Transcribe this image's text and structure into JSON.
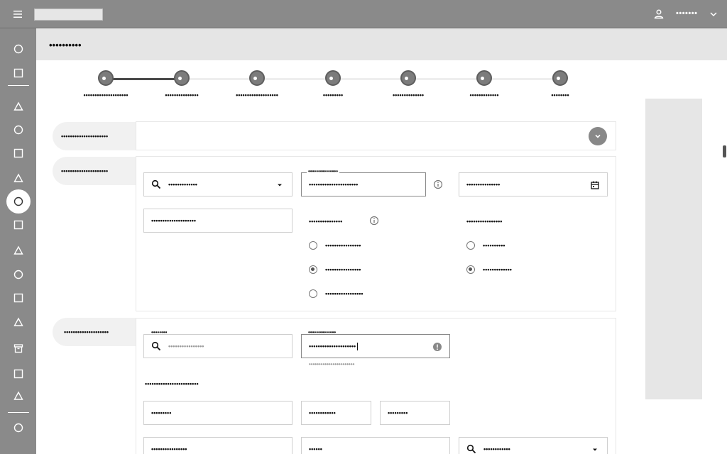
{
  "topbar": {
    "app_name": "",
    "user_name": "•••••••",
    "icons": {
      "menu": "hamburger-icon",
      "user": "person-icon",
      "dropdown": "chevron-down-icon"
    }
  },
  "sidebar": {
    "items": [
      {
        "icon": "circle-icon"
      },
      {
        "icon": "square-icon"
      },
      {
        "icon": "triangle-icon"
      },
      {
        "icon": "circle-icon"
      },
      {
        "icon": "square-icon"
      },
      {
        "icon": "triangle-icon"
      },
      {
        "icon": "circle-icon",
        "active": true
      },
      {
        "icon": "square-icon"
      },
      {
        "icon": "triangle-icon"
      },
      {
        "icon": "circle-icon"
      },
      {
        "icon": "square-icon"
      },
      {
        "icon": "triangle-icon"
      },
      {
        "icon": "archive-icon"
      },
      {
        "icon": "square-icon"
      },
      {
        "icon": "triangle-icon"
      },
      {
        "icon": "circle-icon"
      }
    ]
  },
  "page": {
    "title": "••••••••••"
  },
  "stepper": {
    "completed_through": 1,
    "steps": [
      {
        "label": "••••••••••••••••••••"
      },
      {
        "label": "•••••••••••••••"
      },
      {
        "label": "•••••••••••••••••••"
      },
      {
        "label": "•••••••••"
      },
      {
        "label": "••••••••••••••"
      },
      {
        "label": "•••••••••••••"
      },
      {
        "label": "••••••••"
      }
    ]
  },
  "section1": {
    "tab_label": "•••••••••••••••••••••"
  },
  "section2": {
    "tab_label": "•••••••••••••••••••••",
    "search_select": {
      "value": "•••••••••••••"
    },
    "labeled_input": {
      "label": "•••••••••••••••",
      "value": "••••••••••••••••••••••"
    },
    "date_input": {
      "value": "•••••••••••••••"
    },
    "text_input": {
      "value": "••••••••••••••••••••"
    },
    "radio_group_a": {
      "label": "•••••••••••••••",
      "options": [
        {
          "label": "••••••••••••••••"
        },
        {
          "label": "••••••••••••••••",
          "checked": true
        },
        {
          "label": "•••••••••••••••••"
        }
      ]
    },
    "radio_group_b": {
      "label": "••••••••••••••••",
      "options": [
        {
          "label": "••••••••••"
        },
        {
          "label": "•••••••••••••",
          "checked": true
        }
      ]
    }
  },
  "section3": {
    "tab_label": "••••••••••••••••••••",
    "search_input": {
      "label": "••••••••",
      "placeholder": "••••••••••••••••"
    },
    "error_input": {
      "label": "••••••••••••••",
      "value": "•••••••••••••••••••••",
      "helper": "•••••••••••••••••••••••"
    },
    "sub_heading": "••••••••••••••••••••••••",
    "row1": [
      {
        "value": "•••••••••"
      },
      {
        "value": "••••••••••••"
      },
      {
        "value": "•••••••••"
      }
    ],
    "row2": [
      {
        "value": "••••••••••••••••"
      },
      {
        "value": "••••••"
      },
      {
        "value": "••••••••••••"
      }
    ]
  },
  "colors": {
    "chrome": "#8a8a8a",
    "header_bg": "#e5e5e5",
    "panel_bg": "#e6e6e6",
    "text": "#111111",
    "helper": "#999999"
  }
}
